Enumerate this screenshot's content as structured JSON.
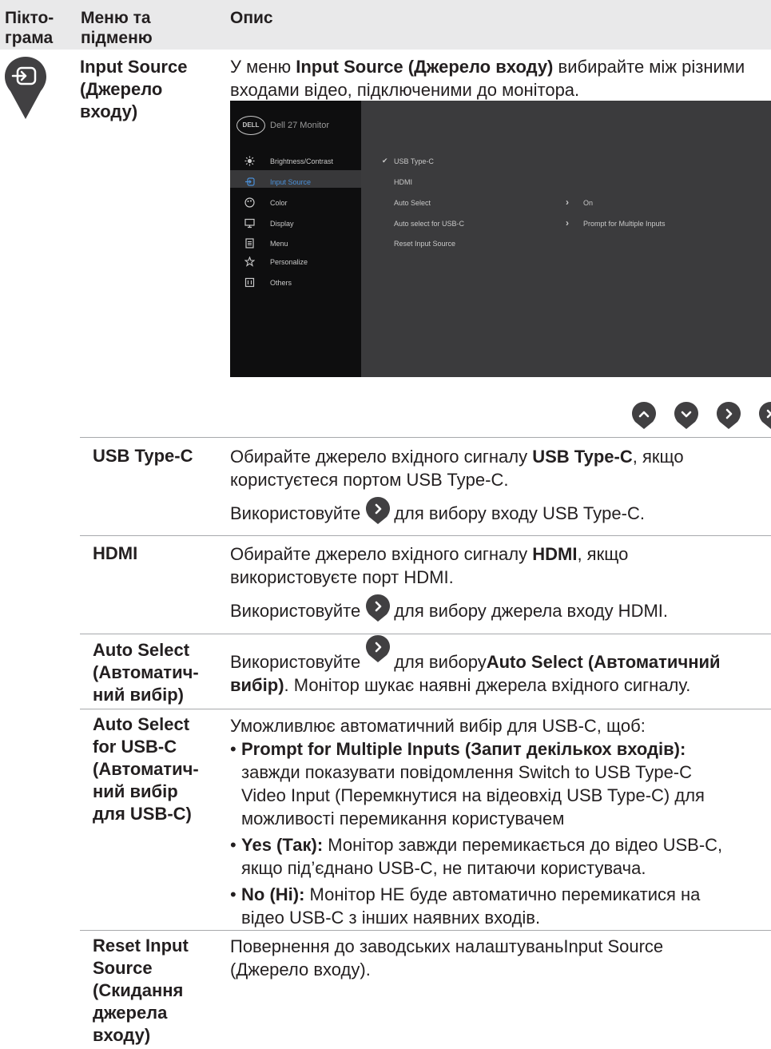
{
  "header": {
    "col1": "Пікто-\nграма",
    "col2": "Меню та\nпідменю",
    "col3": "Опис"
  },
  "input_source": {
    "menu_label": "Input Source\n(Джерело\nвходу)",
    "desc_pre": "У меню ",
    "desc_bold": "Input Source (Джерело входу)",
    "desc_post": " вибирайте між різними входами відео, підключеними до монітора."
  },
  "osd": {
    "logo": "DELL",
    "title": "Dell 27 Monitor",
    "menu": [
      {
        "label": "Brightness/Contrast",
        "icon": "brightness-icon"
      },
      {
        "label": "Input Source",
        "icon": "input-source-icon",
        "selected": true
      },
      {
        "label": "Color",
        "icon": "color-palette-icon"
      },
      {
        "label": "Display",
        "icon": "display-icon"
      },
      {
        "label": "Menu",
        "icon": "menu-icon"
      },
      {
        "label": "Personalize",
        "icon": "star-icon"
      },
      {
        "label": "Others",
        "icon": "others-icon"
      }
    ],
    "options": [
      {
        "label": "USB Type-C",
        "checked": true,
        "value": ""
      },
      {
        "label": "HDMI",
        "value": ""
      },
      {
        "label": "Auto Select",
        "value": "On"
      },
      {
        "label": "Auto select for USB-C",
        "value": "Prompt for Multiple Inputs"
      },
      {
        "label": "Reset Input Source",
        "value": ""
      }
    ],
    "accent_color": "#4a90d9"
  },
  "nav_buttons": [
    "up-icon",
    "down-icon",
    "right-icon",
    "close-icon"
  ],
  "rows": {
    "usbc": {
      "label": "USB Type-C",
      "l1_pre": "Обирайте джерело вхідного сигналу ",
      "l1_bold": "USB Type-C",
      "l1_post": ", якщо",
      "l2": "користуєтеся портом USB Type-C.",
      "use_pre": "Використовуйте",
      "use_post": "для вибору входу USB Type-C."
    },
    "hdmi": {
      "label": "HDMI",
      "l1_pre": "Обирайте джерело вхідного сигналу ",
      "l1_bold": "HDMI",
      "l1_post": ", якщо",
      "l2": "використовуєте порт HDMI.",
      "use_pre": "Використовуйте",
      "use_post": "для вибору джерела входу HDMI."
    },
    "auto": {
      "label": "Auto Select\n(Автоматич-\nний вибір)",
      "use_pre": "Використовуйте",
      "use_mid": "для вибору ",
      "use_bold": "Auto Select (Автоматичний",
      "l2_bold": "вибір)",
      "l2_post": ". Монітор шукає наявні джерела вхідного сигналу."
    },
    "auto_usbc": {
      "label": "Auto Select\nfor USB-C\n(Автоматич-\nний вибір\nдля USB-C)",
      "intro": "Уможливлює автоматичний вибір для USB-C, щоб:",
      "b1_bold": "Prompt for Multiple Inputs (Запит декількох входів):",
      "b1_text": "завжди показувати повідомлення Switch to USB Type-C\nVideo Input (Перемкнутися на відеовхід USB Type-C) для\nможливості перемикання користувачем",
      "b2_bold": "Yes (Так):",
      "b2_text": " Монітор завжди перемикається до відео USB-C,\nякщо під’єднано USB-C, не питаючи користувача.",
      "b3_bold": "No (Ні):",
      "b3_text": " Монітор НЕ буде автоматично перемикатися на\nвідео USB-C з інших наявних входів."
    },
    "reset": {
      "label": "Reset Input\nSource\n(Скидання\nджерела\nвходу)",
      "text": "Повернення до заводських налаштуваньInput Source\n(Джерело входу)."
    }
  }
}
